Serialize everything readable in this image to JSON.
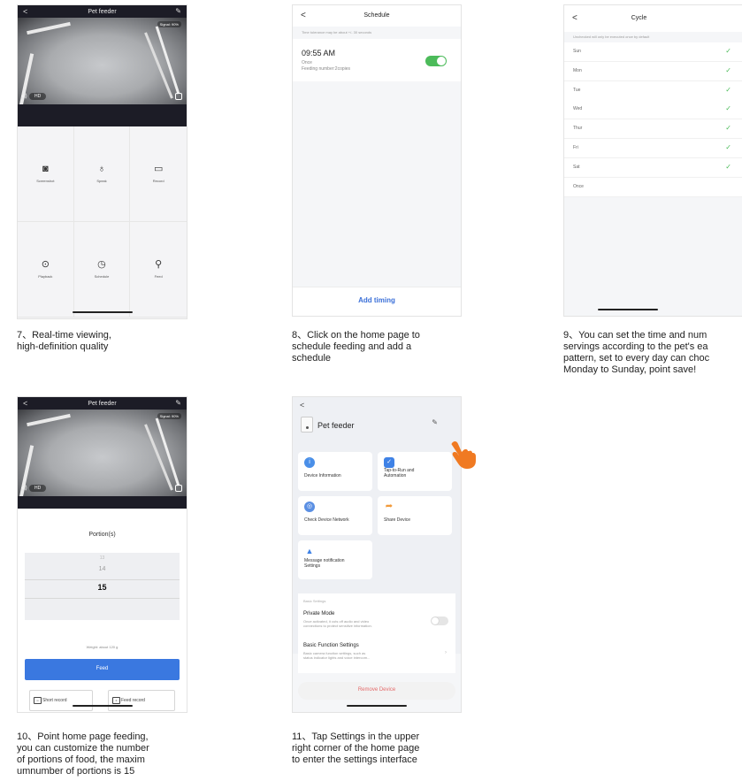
{
  "screens": {
    "s7": {
      "title": "Pet feeder",
      "signal": "Signal: 90%",
      "hd": "HD",
      "controls": [
        {
          "label": "Screenshot",
          "icon": "camera-icon"
        },
        {
          "label": "Speak",
          "icon": "microphone-icon"
        },
        {
          "label": "Record",
          "icon": "video-icon"
        },
        {
          "label": "Playback",
          "icon": "playback-icon"
        },
        {
          "label": "Schedule",
          "icon": "clock-icon"
        },
        {
          "label": "Feed",
          "icon": "bone-icon"
        }
      ]
    },
    "s8": {
      "title": "Schedule",
      "tip": "Time tolerance may be about +/- 30 seconds",
      "time": "09:55 AM",
      "sub": "Once\nFeeding number:2copies",
      "toggle_on": true,
      "add_label": "Add timing"
    },
    "s9": {
      "title": "Cycle",
      "tip": "Unchecked will only be executed once by default",
      "days": [
        {
          "day": "Sun",
          "checked": true
        },
        {
          "day": "Mon",
          "checked": true
        },
        {
          "day": "Tue",
          "checked": true
        },
        {
          "day": "Wed",
          "checked": true
        },
        {
          "day": "Thur",
          "checked": true
        },
        {
          "day": "Fri",
          "checked": true
        },
        {
          "day": "Sat",
          "checked": true
        },
        {
          "day": "Once",
          "checked": false
        }
      ],
      "check_glyph": "✓"
    },
    "s10": {
      "title": "Pet feeder",
      "signal": "Signal: 90%",
      "hd": "HD",
      "portion_title": "Portion(s)",
      "picker": [
        "13",
        "14",
        "15"
      ],
      "weight": "Weight: about 120 g",
      "feed_label": "Feed",
      "short_record": "Short record",
      "feed_record": "Feed record"
    },
    "s11": {
      "device_name": "Pet feeder",
      "tiles": [
        {
          "label": "Device Information",
          "color": "#4a8fe8",
          "glyph": "i"
        },
        {
          "label": "Tap-to-Run and\nAutomation",
          "color": "#3f82e6",
          "glyph": "✓"
        },
        {
          "label": "Check Device Network",
          "color": "#5a8fe3",
          "glyph": "◎"
        },
        {
          "label": "Share Device",
          "color": "#f29a3a",
          "glyph": "➦"
        },
        {
          "label": "Message notification\nSettings",
          "color": "#3f82e6",
          "glyph": "▲"
        }
      ],
      "basic_head": "Basic Settings",
      "private_title": "Private Mode",
      "private_desc": "Once activated, it cuts off audio and video\nconnections to protect sensitive information.",
      "basic_title": "Basic Function Settings",
      "basic_desc": "Basic camera function settings, such as\nstatus indicator lights and voice intercom...",
      "remove_label": "Remove Device"
    }
  },
  "captions": {
    "c7": "7、Real-time viewing,\nhigh-definition quality",
    "c8": "8、Click on the home page to\nschedule feeding and add a\nschedule",
    "c9": "9、You can set the time and num\nservings according to the pet's ea\npattern, set to every day can choc\nMonday to Sunday, point save!",
    "c10": "10、Point home page feeding,\nyou can customize the number\nof portions of food, the maxim\numnumber of portions is 15",
    "c11": "11、Tap Settings in the upper\nright corner of the home page\nto enter the settings interface"
  }
}
